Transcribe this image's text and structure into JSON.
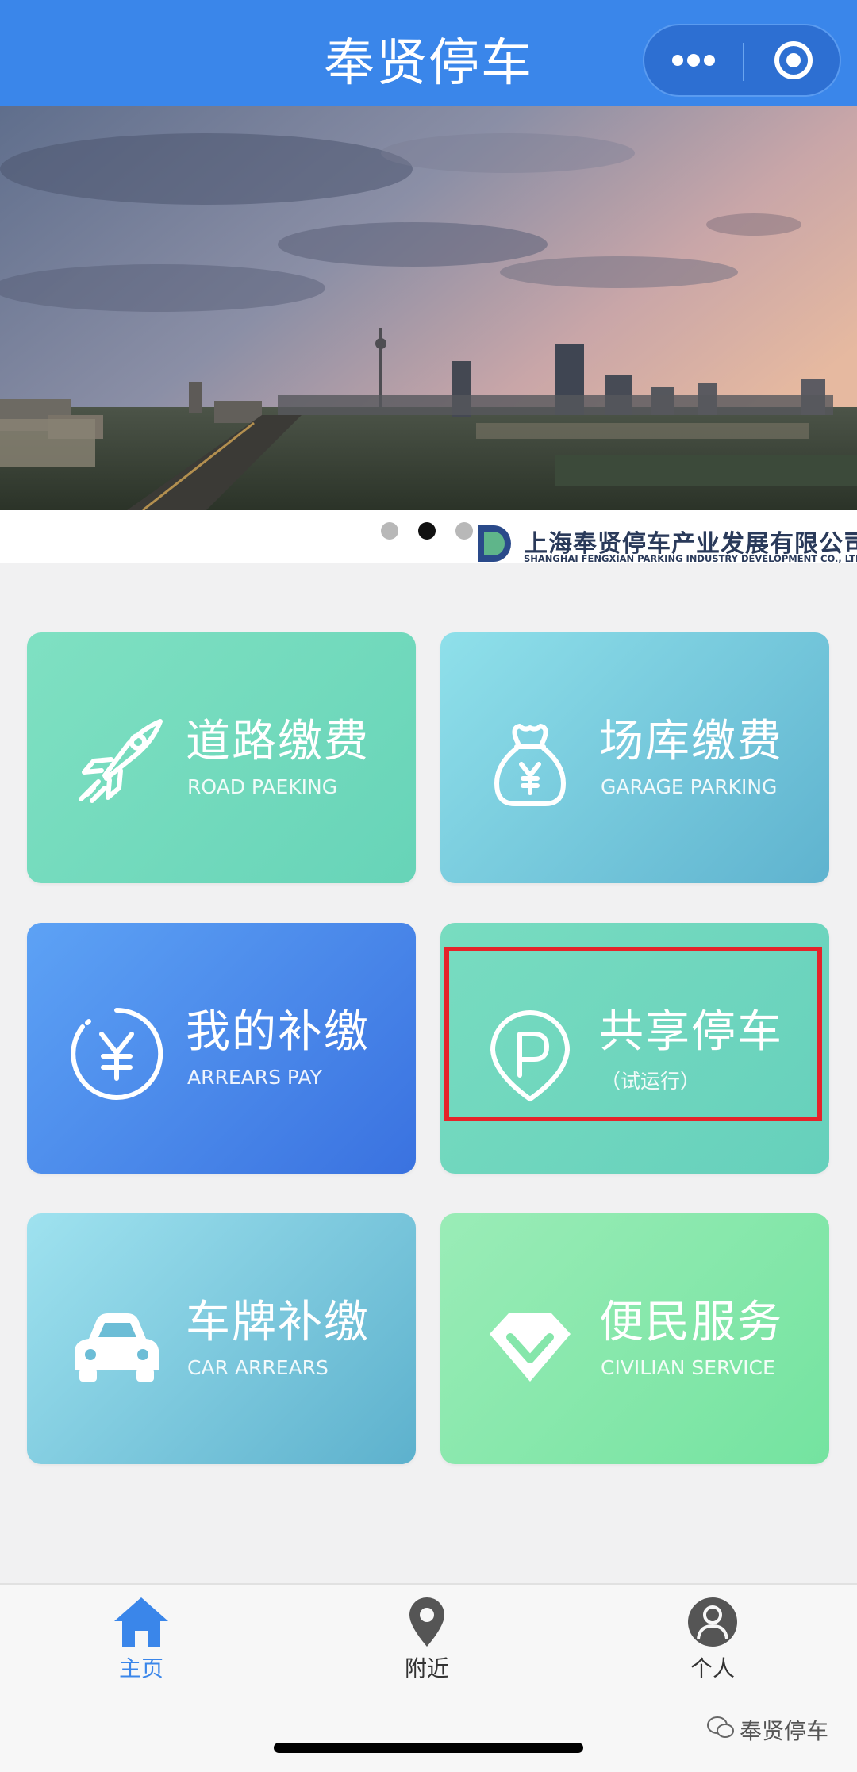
{
  "header": {
    "title": "奉贤停车"
  },
  "banner": {
    "company_cn": "上海奉贤停车产业发展有限公司",
    "company_en": "SHANGHAI FENGXIAN PARKING INDUSTRY DEVELOPMENT CO., LTD",
    "carousel": {
      "total": 3,
      "active_index": 1
    }
  },
  "tiles": [
    {
      "cn": "道路缴费",
      "en": "ROAD PAEKING",
      "icon": "rocket-icon"
    },
    {
      "cn": "场库缴费",
      "en": "GARAGE PARKING",
      "icon": "money-bag-icon"
    },
    {
      "cn": "我的补缴",
      "en": "ARREARS PAY",
      "icon": "yen-circle-icon"
    },
    {
      "cn": "共享停车",
      "en": "（试运行）",
      "icon": "parking-pin-icon"
    },
    {
      "cn": "车牌补缴",
      "en": "CAR ARREARS",
      "icon": "car-icon"
    },
    {
      "cn": "便民服务",
      "en": "CIVILIAN SERVICE",
      "icon": "diamond-check-icon"
    }
  ],
  "tabbar": {
    "items": [
      {
        "label": "主页",
        "icon": "home-icon",
        "active": true
      },
      {
        "label": "附近",
        "icon": "location-pin-icon",
        "active": false
      },
      {
        "label": "个人",
        "icon": "person-icon",
        "active": false
      }
    ]
  },
  "watermark": {
    "text": "奉贤停车",
    "icon": "wechat-icon"
  },
  "colors": {
    "header": "#3a86ea",
    "highlight": "#e5232a",
    "tab_active": "#3a86ea",
    "tab_inactive": "#555555"
  }
}
